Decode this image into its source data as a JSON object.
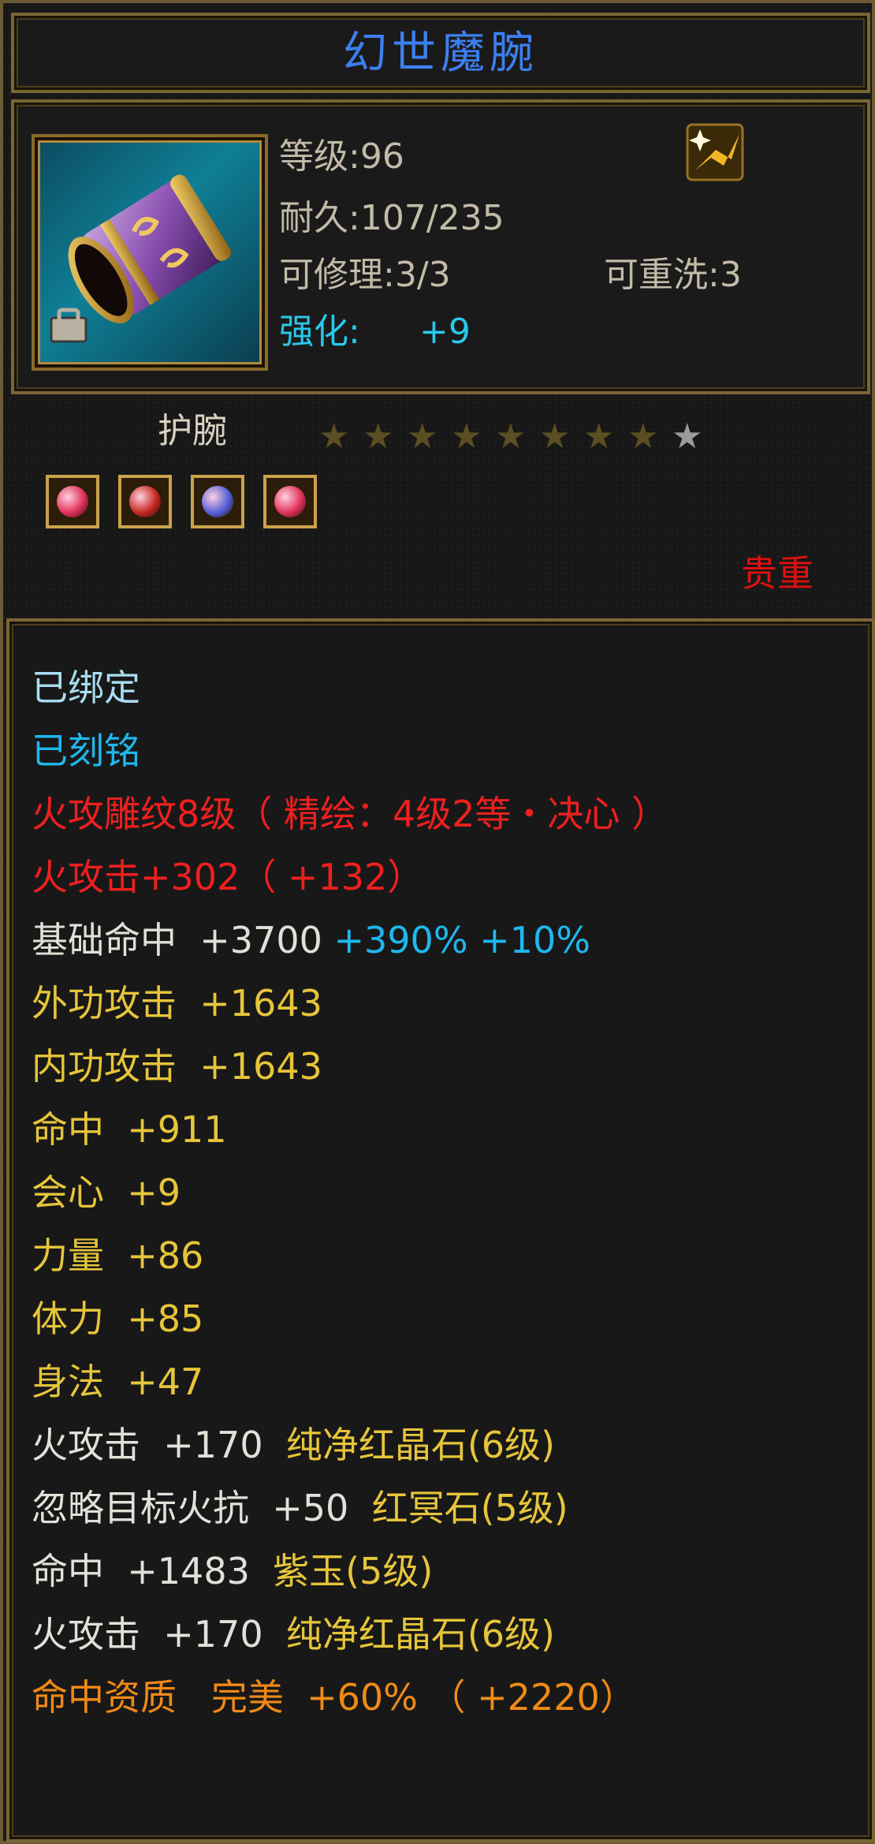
{
  "item": {
    "name": "幻世魔腕",
    "icon": "bracer-icon",
    "level_text": "等级:96",
    "durability_text": "耐久:107/235",
    "repairable_text": "可修理:3/3",
    "rewash_text": "可重洗:3",
    "enhance_label": "强化:",
    "enhance_value": "+9",
    "type": "护腕",
    "stars_filled": 8,
    "stars_total": 9,
    "gem_colors": [
      "#e0325a",
      "#c4281e",
      "#5560d8",
      "#e0325a"
    ],
    "rarity": "贵重"
  },
  "attributes": {
    "bound": "已绑定",
    "engraved": "已刻铭",
    "carving": "火攻雕纹8级（ 精绘：4级2等・决心 ）",
    "fire_attack": "火攻击+302（ +132）",
    "base_hit_label": "基础命中  +3700",
    "base_hit_bonus": "+390% +10%",
    "lines_yellow": [
      "外功攻击  +1643",
      "内功攻击  +1643",
      "命中  +911",
      "会心  +9",
      "力量  +86",
      "体力  +85",
      "身法  +47"
    ],
    "gem_lines": [
      {
        "stat": "火攻击  +170  ",
        "gem": "纯净红晶石(6级)"
      },
      {
        "stat": "忽略目标火抗  +50  ",
        "gem": "红冥石(5级)"
      },
      {
        "stat": "命中  +1483  ",
        "gem": "紫玉(5级)"
      },
      {
        "stat": "火攻击  +170  ",
        "gem": "纯净红晶石(6级)"
      }
    ],
    "aptitude": "命中资质   完美  +60% （ +2220）"
  },
  "colors": {
    "title": "#3d7ff0",
    "gold_border": "#7a6535",
    "red": "#ef1f1f",
    "cyan": "#1fb8ee",
    "yellow": "#e6c53a",
    "orange": "#f08a16"
  }
}
